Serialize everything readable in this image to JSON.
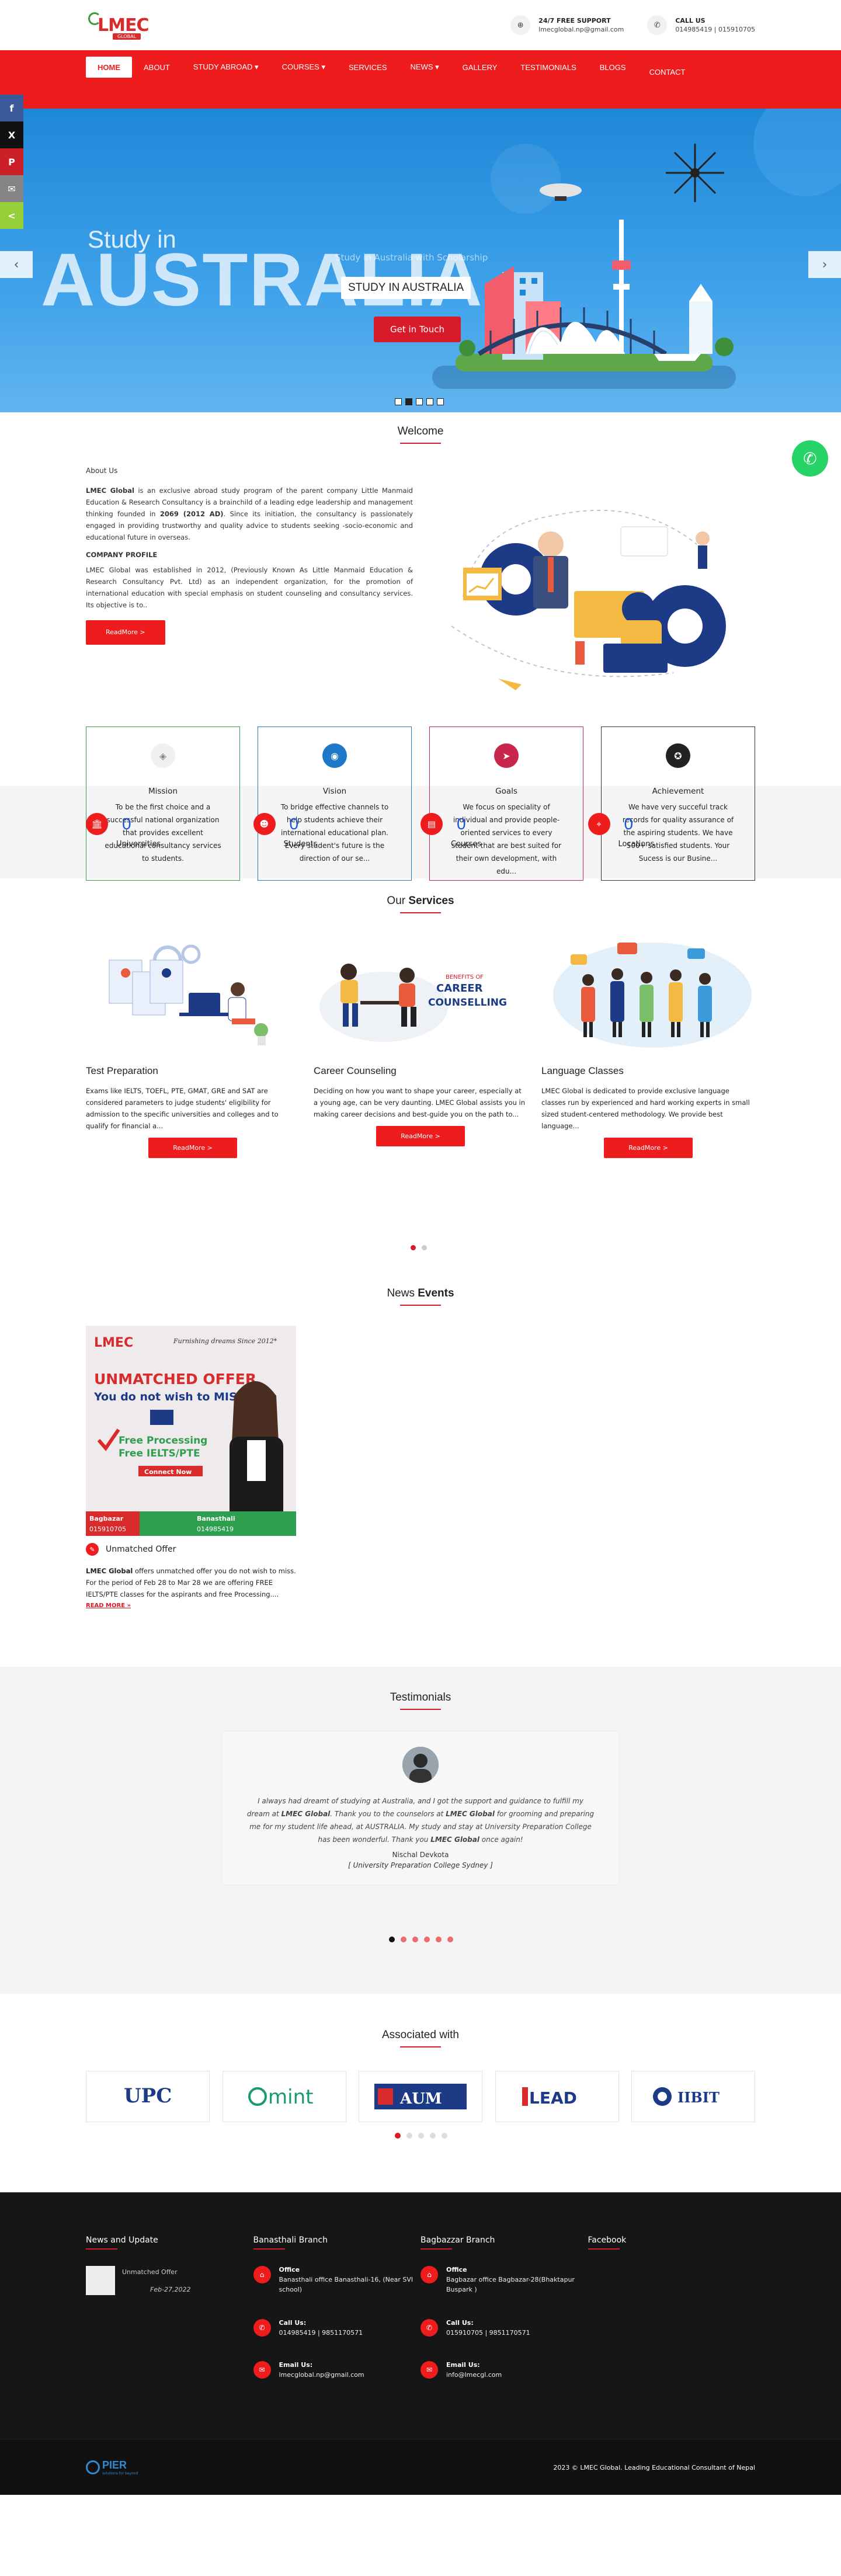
{
  "header": {
    "logo_text": "LMEC",
    "logo_sub": "GLOBAL",
    "support_label": "24/7 FREE SUPPORT",
    "support_email": "lmecglobal.np@gmail.com",
    "call_label": "CALL US",
    "call_numbers": "014985419 | 015910705"
  },
  "nav": {
    "items": [
      "HOME",
      "ABOUT",
      "STUDY ABROAD ▾",
      "COURSES ▾",
      "SERVICES",
      "NEWS ▾",
      "GALLERY",
      "TESTIMONIALS",
      "BLOGS",
      "CONTACT"
    ],
    "active": "HOME",
    "accent": "#ee1c1c"
  },
  "social": [
    "f",
    "X",
    "P",
    "✉",
    "<"
  ],
  "hero": {
    "study_in": "Study in",
    "country": "AUSTRALIA",
    "ghost": "Study in Australia with Scholarship",
    "caption": "STUDY IN AUSTRALIA",
    "cta": "Get in Touch",
    "prev": "‹",
    "next": "›"
  },
  "welcome": {
    "title": "Welcome",
    "about_heading": "About Us",
    "about_brand": "LMEC Global",
    "about_p1": " is an exclusive abroad study program of the parent company Little Manmaid Education & Research Consultancy  is a brainchild of a leading edge leadership and management thinking founded in ",
    "about_year": "2069 (2012 AD)",
    "about_p1_end": ". Since its initiation, the consultancy is passionately engaged in providing trustworthy and quality advice to students seeking -socio-economic and educational future in overseas.",
    "profile_heading": "COMPANY PROFILE",
    "profile_p": "LMEC Global was established in 2012, (Previously Known As Little Manmaid Education & Research Consultancy Pvt. Ltd) as an independent organization, for the promotion of international education with special emphasis on student counseling and consultancy services. Its objective is to..",
    "readmore": "ReadMore >"
  },
  "cards": [
    {
      "title": "Mission",
      "text": "To be the first choice and a successful national organization that provides excellent educational consultancy services to students.",
      "color": "#2e9e4f",
      "icon": "◈"
    },
    {
      "title": "Vision",
      "text": "To bridge effective channels to help students achieve their international educational plan. Every student's future is the direction of our se...",
      "color": "#1e77c9",
      "icon": "◉"
    },
    {
      "title": "Goals",
      "text": "We focus on speciality of individual and provide people-oriented services to every student that are best suited for their own development, with edu...",
      "color": "#c9264b",
      "icon": "➤"
    },
    {
      "title": "Achievement",
      "text": "We have very succeful track records for quality assurance of the aspiring students. We have 500+ satisfied students. Your Sucess is our Busine...",
      "color": "#333333",
      "icon": "✪"
    }
  ],
  "stats": [
    {
      "value": "0",
      "label": "Universities",
      "icon": "🏛"
    },
    {
      "value": "0",
      "label": "Students",
      "icon": "☻"
    },
    {
      "value": "0",
      "label": "Courses",
      "icon": "▤"
    },
    {
      "value": "0",
      "label": "Locations",
      "icon": "⌖"
    }
  ],
  "services": {
    "title_a": "Our ",
    "title_b": "Services",
    "items": [
      {
        "title": "Test Preparation",
        "text": "Exams like IELTS, TOEFL, PTE, GMAT, GRE and SAT are considered parameters to judge students' eligibility for admission to the specific universities and colleges and to qualify for financial a...",
        "button": "ReadMore >"
      },
      {
        "title": "Career Counseling",
        "text": "Deciding on how you want to shape your career, especially at a young age, can be very daunting. LMEC Global assists you in making career decisions and best-guide you on the path to...",
        "button": "ReadMore >"
      },
      {
        "title": "Language Classes",
        "text": "LMEC Global is dedicated to provide exclusive language classes run by experienced and hard working experts in small sized student-centered methodology. We provide best language...",
        "button": "ReadMore >"
      }
    ],
    "art_text": [
      "BENEFITS OF",
      "CAREER",
      "COUNSELLING"
    ]
  },
  "news": {
    "title_a": "News ",
    "title_b": "Events",
    "poster": {
      "tag": "Furnishing dreams Since 2012*",
      "headline1": "UNMATCHED OFFER",
      "headline2": "You do not wish to MISS",
      "free1": "Free Processing",
      "free2": "Free IELTS/PTE",
      "connect": "Connect Now",
      "branch1": "Bagbazar",
      "phone1": "015910705",
      "branch2": "Banasthali",
      "phone2": "014985419"
    },
    "item_title": "Unmatched Offer",
    "item_text_brand": "LMEC Global",
    "item_text": " offers unmatched offer you do not wish to miss. For the period of Feb 28 to Mar 28 we are offering FREE IELTS/PTE classes for the aspirants and free Processing....",
    "more": "READ MORE »"
  },
  "testimonials": {
    "title": "Testimonials",
    "quote_a": "I always had dreamt of studying at Australia, and I got the support and guidance to fulfill my dream at ",
    "quote_brand": "LMEC Global",
    "quote_b": ". Thank you to the counselors at ",
    "quote_brand2": "LMEC Global",
    "quote_c": " for grooming and preparing me for my student life ahead, at AUSTRALIA. My study and stay at University Preparation College has been wonderful. Thank you ",
    "quote_brand3": "LMEC Global",
    "quote_d": " once again!",
    "name": "Nischal Devkota",
    "institution": "[ University Preparation College Sydney ]"
  },
  "associated": {
    "title": "Associated with",
    "logos": [
      "UPC",
      "mint",
      "AUM",
      "LEAD",
      "IIBIT"
    ]
  },
  "footer": {
    "col1": {
      "title": "News and Update",
      "item": "Unmatched Offer",
      "date": "Feb-27,2022"
    },
    "col2": {
      "title": "Banasthali Branch",
      "office_label": "Office",
      "office": "Banasthali office Banasthali-16, (Near SVI school)",
      "call_label": "Call Us:",
      "call": "014985419 | 9851170571",
      "email_label": "Email Us:",
      "email": "lmecglobal.np@gmail.com"
    },
    "col3": {
      "title": "Bagbazzar Branch",
      "office_label": "Office",
      "office": "Bagbazar office Bagbazar-28(Bhaktapur Buspark )",
      "call_label": "Call Us:",
      "call": "015910705 | 9851170571",
      "email_label": "Email Us:",
      "email": "info@lmecgl.com"
    },
    "col4": {
      "title": "Facebook"
    },
    "brand": "PIER",
    "brand_sub": "solutions for beyond",
    "copyright": "2023 © LMEC Global. Leading Educational Consultant of Nepal"
  }
}
